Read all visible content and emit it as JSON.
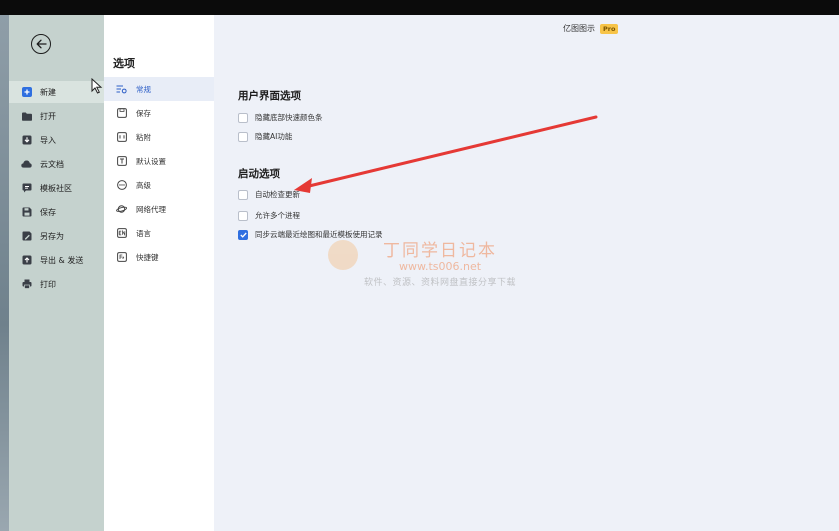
{
  "file_menu": {
    "items": [
      {
        "label": "新建",
        "icon": "plus-square-icon",
        "active": true
      },
      {
        "label": "打开",
        "icon": "folder-icon"
      },
      {
        "label": "导入",
        "icon": "import-icon"
      },
      {
        "label": "云文档",
        "icon": "cloud-icon"
      },
      {
        "label": "模板社区",
        "icon": "template-icon"
      },
      {
        "label": "保存",
        "icon": "save-icon"
      },
      {
        "label": "另存为",
        "icon": "save-as-icon"
      },
      {
        "label": "导出 & 发送",
        "icon": "export-icon"
      },
      {
        "label": "打印",
        "icon": "printer-icon"
      }
    ]
  },
  "options": {
    "title": "选项",
    "items": [
      {
        "label": "常规",
        "icon": "settings-sliders-icon",
        "active": true
      },
      {
        "label": "保存",
        "icon": "save-icon"
      },
      {
        "label": "粘附",
        "icon": "snap-icon"
      },
      {
        "label": "默认设置",
        "icon": "text-defaults-icon"
      },
      {
        "label": "高级",
        "icon": "more-circle-icon"
      },
      {
        "label": "网络代理",
        "icon": "planet-icon"
      },
      {
        "label": "语言",
        "icon": "language-icon"
      },
      {
        "label": "快捷键",
        "icon": "shortcut-key-icon"
      }
    ]
  },
  "header": {
    "brand": "亿图图示",
    "badge": "Pro"
  },
  "ui_section": {
    "title": "用户界面选项",
    "options": [
      {
        "label": "隐藏底部快速颜色条",
        "checked": false
      },
      {
        "label": "隐藏AI功能",
        "checked": false
      }
    ]
  },
  "startup_section": {
    "title": "启动选项",
    "options": [
      {
        "label": "自动检查更新",
        "checked": false
      },
      {
        "label": "允许多个进程",
        "checked": false
      },
      {
        "label": "同步云端最近绘图和最近模板使用记录",
        "checked": true
      }
    ]
  },
  "watermark": {
    "title": "丁同学日记本",
    "url": "www.ts006.net",
    "subtitle": "软件、资源、资料网盘直接分享下载"
  },
  "colors": {
    "accent": "#2f6fe0",
    "annotation_arrow": "#e53935",
    "badge": "#f7c448"
  }
}
